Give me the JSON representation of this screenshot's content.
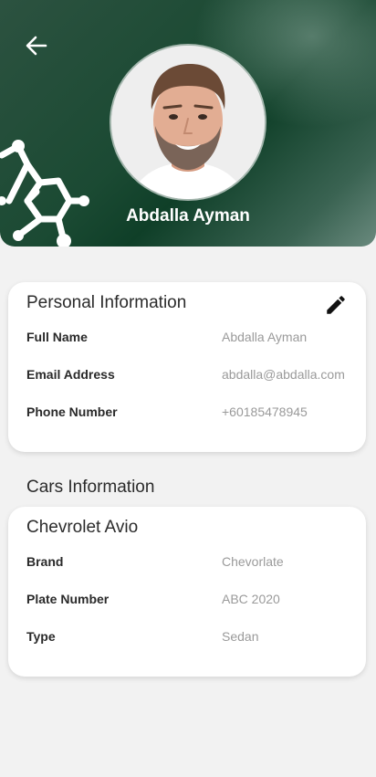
{
  "header": {
    "back_icon": "arrow-left-icon",
    "decoration_icon": "molecule-icon",
    "user_name": "Abdalla Ayman",
    "colors": {
      "gradient_dark": "#0f3f28",
      "gradient_light": "#6a8a7e"
    }
  },
  "personal": {
    "title": "Personal Information",
    "edit_icon": "pencil-icon",
    "rows": [
      {
        "label": "Full Name",
        "value": "Abdalla Ayman"
      },
      {
        "label": "Email Address",
        "value": "abdalla@abdalla.com"
      },
      {
        "label": "Phone Number",
        "value": "+60185478945"
      }
    ]
  },
  "cars": {
    "section_title": "Cars Information",
    "car": {
      "title": "Chevrolet Avio",
      "rows": [
        {
          "label": "Brand",
          "value": "Chevorlate"
        },
        {
          "label": "Plate Number",
          "value": "ABC 2020"
        },
        {
          "label": "Type",
          "value": "Sedan"
        }
      ]
    }
  }
}
